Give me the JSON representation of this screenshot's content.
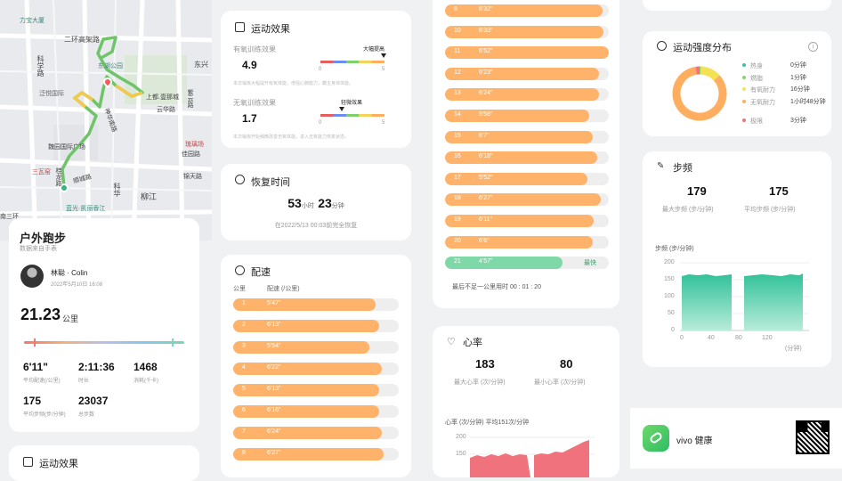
{
  "map": {
    "labels": [
      {
        "id": "lidaguo",
        "text": "力宝大厦"
      },
      {
        "id": "erhuan",
        "text": "二环高架路"
      },
      {
        "id": "donghu",
        "text": "东湖公园"
      },
      {
        "id": "dongxing",
        "text": "东兴"
      },
      {
        "id": "kexue",
        "text": "科学路"
      },
      {
        "id": "fanwei",
        "text": "泛悦国际"
      },
      {
        "id": "shangdu",
        "text": "上都.壹那城"
      },
      {
        "id": "yunhua",
        "text": "云华路"
      },
      {
        "id": "shenhua",
        "text": "神华南路"
      },
      {
        "id": "weiyi",
        "text": "魏园国际广场"
      },
      {
        "id": "liuli",
        "text": "琉璃场"
      },
      {
        "id": "sanwa",
        "text": "三瓦窑"
      },
      {
        "id": "jiayuan",
        "text": "佳园路"
      },
      {
        "id": "dongfeng",
        "text": "顺城路"
      },
      {
        "id": "guilong",
        "text": "桂龙路"
      },
      {
        "id": "hangzhou",
        "text": "科华"
      },
      {
        "id": "liujiang",
        "text": "柳江"
      },
      {
        "id": "jintian",
        "text": "锦天路"
      },
      {
        "id": "sanhuan",
        "text": "南三环"
      },
      {
        "id": "lanteng",
        "text": "蓝光·凯丽香江"
      },
      {
        "id": "ziyun",
        "text": "紫云路"
      }
    ]
  },
  "summary": {
    "title": "户外跑步",
    "source": "数据来自手表",
    "user": "林聪 · Colin",
    "datetime": "2022年5月10日 16:08",
    "distance": "21.23",
    "distance_unit": "公里",
    "stats": [
      {
        "value": "6'11\"",
        "label": "平均配速(/公里)"
      },
      {
        "value": "2:11:36",
        "label": "时长"
      },
      {
        "value": "1468",
        "label": "消耗(千卡)"
      },
      {
        "value": "175",
        "label": "平均步频(步/分钟)"
      },
      {
        "value": "23037",
        "label": "总步数"
      }
    ]
  },
  "effect": {
    "title": "运动效果",
    "aero_label": "有氧训练效果",
    "aero_value": "4.9",
    "aero_tag": "大幅提高",
    "aero_desc": "本次锻炼大幅提升有氧体能，增强心肺能力，霸主身体体能。",
    "anaero_label": "无氧训练效果",
    "anaero_value": "1.7",
    "anaero_tag": "轻微效果",
    "anaero_desc": "本次锻炼开始稍微改善无氧体能，进入无氧能力恢复状态。",
    "scale_min": "0",
    "scale_max": "5"
  },
  "effect2": {
    "title": "运动效果"
  },
  "recovery": {
    "title": "恢复时间",
    "hours": "53",
    "hours_unit": "小时",
    "mins": "23",
    "mins_unit": "分钟",
    "note": "在2022/5/13 00:03前完全恢复"
  },
  "pace": {
    "title": "配速",
    "col_km": "公里",
    "col_pace": "配速 (/公里)",
    "rows": [
      {
        "km": "1",
        "pace": "5'47\"",
        "pct": 0.86
      },
      {
        "km": "2",
        "pace": "6'13\"",
        "pct": 0.88
      },
      {
        "km": "3",
        "pace": "5'54\"",
        "pct": 0.82
      },
      {
        "km": "4",
        "pace": "6'22\"",
        "pct": 0.9
      },
      {
        "km": "5",
        "pace": "6'13\"",
        "pct": 0.88
      },
      {
        "km": "6",
        "pace": "6'16\"",
        "pct": 0.88
      },
      {
        "km": "7",
        "pace": "6'24\"",
        "pct": 0.9
      },
      {
        "km": "8",
        "pace": "6'27\"",
        "pct": 0.91
      }
    ]
  },
  "pace2": {
    "rows": [
      {
        "km": "9",
        "pace": "6'32\"",
        "pct": 0.96,
        "fast": false
      },
      {
        "km": "10",
        "pace": "6'33\"",
        "pct": 0.97,
        "fast": false
      },
      {
        "km": "11",
        "pace": "6'52\"",
        "pct": 1.0,
        "fast": false
      },
      {
        "km": "12",
        "pace": "6'23\"",
        "pct": 0.94,
        "fast": false
      },
      {
        "km": "13",
        "pace": "6'24\"",
        "pct": 0.94,
        "fast": false
      },
      {
        "km": "14",
        "pace": "5'58\"",
        "pct": 0.88,
        "fast": false
      },
      {
        "km": "15",
        "pace": "6'7\"",
        "pct": 0.9,
        "fast": false
      },
      {
        "km": "16",
        "pace": "6'18\"",
        "pct": 0.93,
        "fast": false
      },
      {
        "km": "17",
        "pace": "5'52\"",
        "pct": 0.87,
        "fast": false
      },
      {
        "km": "18",
        "pace": "6'27\"",
        "pct": 0.95,
        "fast": false
      },
      {
        "km": "19",
        "pace": "6'11\"",
        "pct": 0.91,
        "fast": false
      },
      {
        "km": "20",
        "pace": "6'6\"",
        "pct": 0.9,
        "fast": false
      },
      {
        "km": "21",
        "pace": "4'57\"",
        "pct": 0.72,
        "fast": true
      }
    ],
    "fast_label": "最快",
    "last_note": "最后不足一公里用时 00 : 01 : 20"
  },
  "hr": {
    "title": "心率",
    "max": "183",
    "max_label": "最大心率 (次/分钟)",
    "min": "80",
    "min_label": "最小心率 (次/分钟)",
    "chart_label": "心率 (次/分钟)   平均151次/分钟",
    "y200": "200",
    "y150": "150"
  },
  "intensity": {
    "title": "运动强度分布",
    "items": [
      {
        "name": "热身",
        "value": "0分钟",
        "color": "#3ac3a8",
        "minutes": 0
      },
      {
        "name": "燃脂",
        "value": "1分钟",
        "color": "#8dd36a",
        "minutes": 1
      },
      {
        "name": "有氧耐力",
        "value": "16分钟",
        "color": "#f4e253",
        "minutes": 16
      },
      {
        "name": "无氧耐力",
        "value": "1小时48分钟",
        "color": "#ffad5e",
        "minutes": 108
      },
      {
        "name": "极限",
        "value": "3分钟",
        "color": "#ff6f6f",
        "minutes": 3
      }
    ]
  },
  "cadence": {
    "title": "步频",
    "max": "179",
    "max_label": "最大步频 (步/分钟)",
    "avg": "175",
    "avg_label": "平均步频 (步/分钟)",
    "chart_label": "步频 (步/分钟)",
    "yticks": [
      "200",
      "150",
      "100",
      "50",
      "0"
    ],
    "xticks": [
      "0",
      "40",
      "80",
      "120"
    ],
    "xunit": "(分钟)"
  },
  "footer": {
    "brand": "vivo 健康"
  }
}
